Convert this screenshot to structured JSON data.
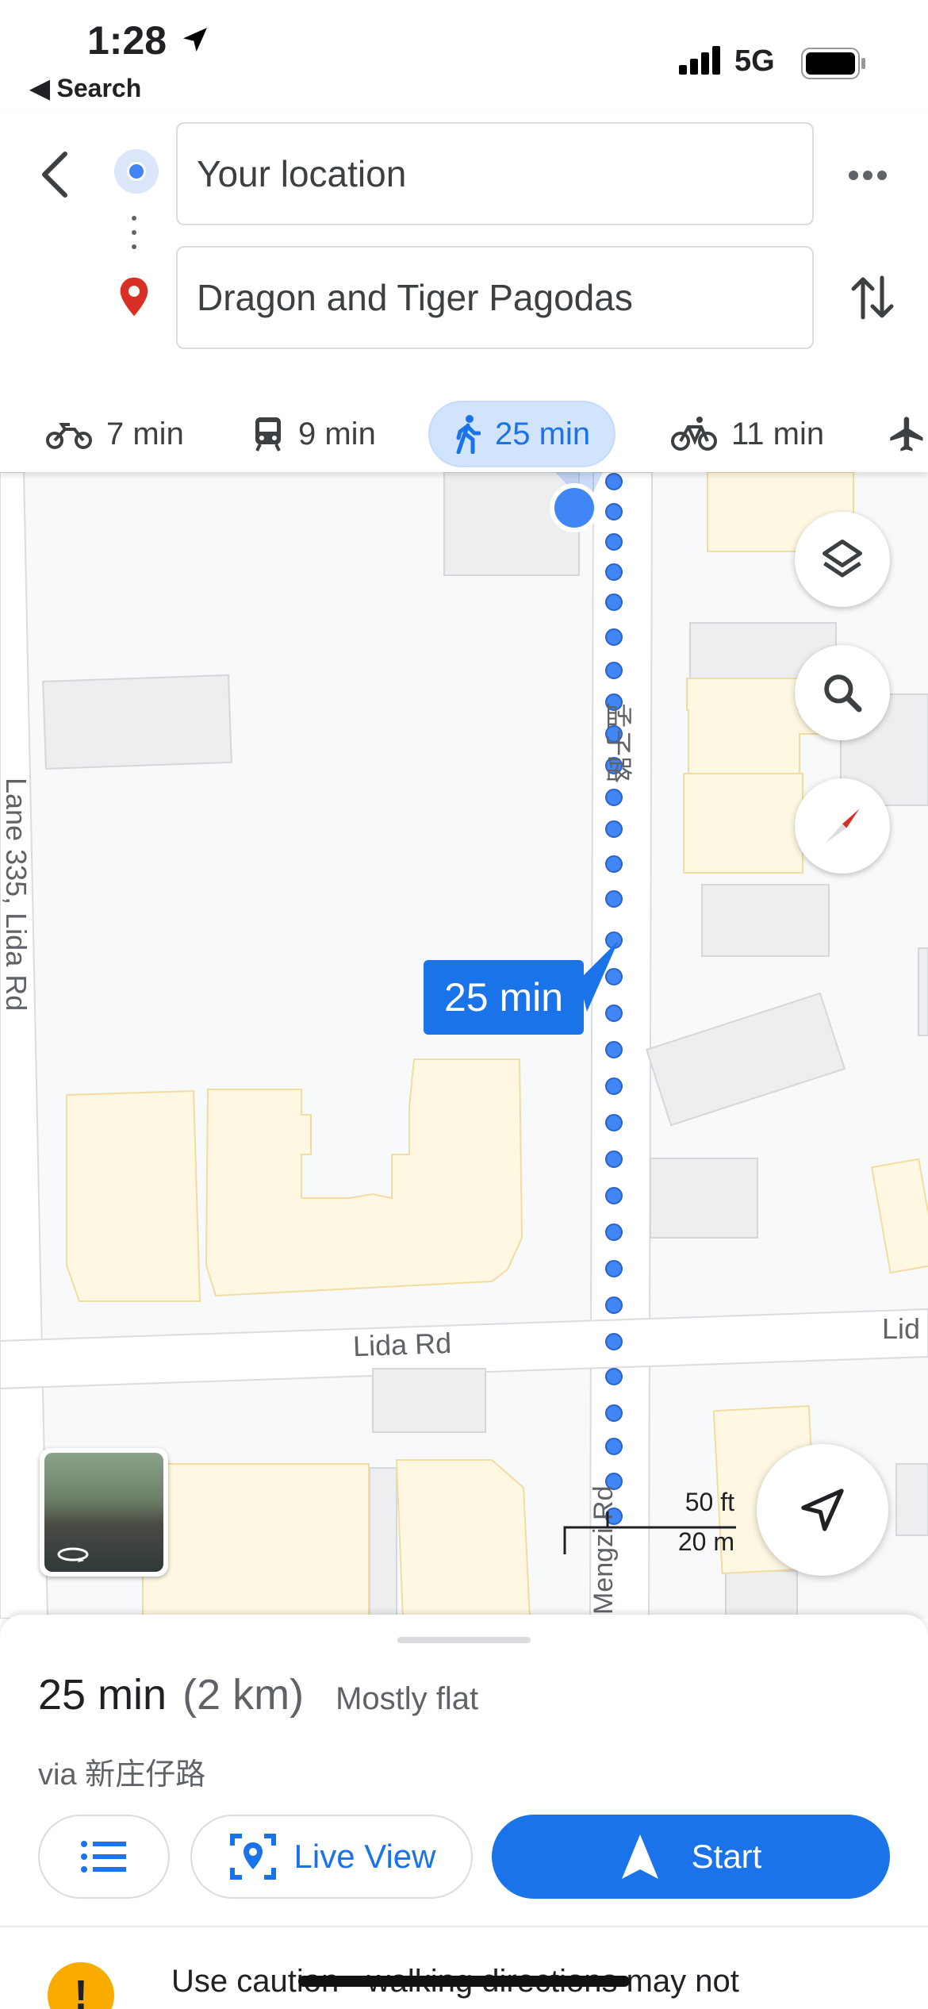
{
  "status_bar": {
    "time": "1:28",
    "back_app": "◀ Search",
    "network": "5G"
  },
  "route": {
    "origin": "Your location",
    "destination": "Dragon and Tiger Pagodas"
  },
  "modes": [
    {
      "icon": "motorcycle-icon",
      "label": "7 min"
    },
    {
      "icon": "transit-icon",
      "label": "9 min"
    },
    {
      "icon": "walk-icon",
      "label": "25 min",
      "active": true
    },
    {
      "icon": "bike-icon",
      "label": "11 min"
    },
    {
      "icon": "flight-icon",
      "label": ""
    }
  ],
  "map": {
    "route_time_label": "25 min",
    "street_lane": "Lane 335, Lida Rd",
    "street_mengzi_cn": "孟子路",
    "street_lida": "Lida Rd",
    "street_lida_partial": "Lid",
    "street_mengzi_en": "Mengzi Rd",
    "scale_ft": "50 ft",
    "scale_m": "20 m",
    "colors": {
      "route": "#4285f4",
      "building": "#eceef0",
      "commercial": "#fef8e3",
      "road": "#ffffff"
    }
  },
  "sheet": {
    "time": "25 min",
    "distance": "(2 km)",
    "terrain": "Mostly flat",
    "via": "via 新庄仔路",
    "live_view_label": "Live View",
    "start_label": "Start",
    "warning_icon_text": "!",
    "warning_text": "Use caution - walking directions may not"
  }
}
